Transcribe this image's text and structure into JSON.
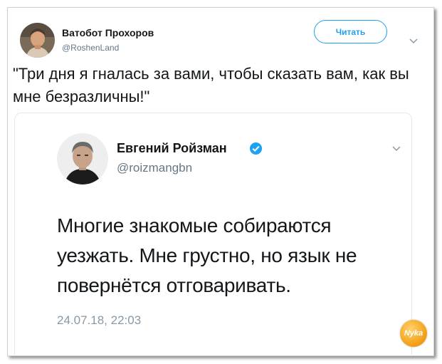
{
  "tweet": {
    "author_name": "Ватобот Прохоров",
    "author_handle": "@RoshenLand",
    "follow_label": "Читать",
    "text": "\"Три дня я гналась за вами, чтобы сказать вам, как вы мне безразличны!\"",
    "avatar_icon": "user-avatar",
    "menu_icon": "chevron-down-icon"
  },
  "quoted_tweet": {
    "author_name": "Евгений Ройзман",
    "author_handle": "@roizmangbn",
    "verified": true,
    "text": "Многие знакомые собираются уезжать. Мне грустно, но язык не повернётся отговаривать.",
    "timestamp": "24.07.18, 22:03",
    "menu_icon": "chevron-down-icon"
  },
  "watermark": {
    "text": "Nyka",
    "color": "#f39c12"
  },
  "colors": {
    "accent": "#1da1f2",
    "secondary_text": "#657786",
    "timestamp_text": "#8899a6"
  }
}
